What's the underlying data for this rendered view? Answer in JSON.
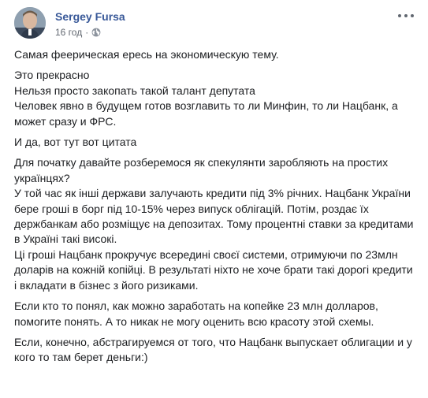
{
  "post": {
    "author": "Sergey Fursa",
    "timestamp": "16 год",
    "separator": "·",
    "privacy_icon": "globe-icon",
    "more_icon": "more-options-icon",
    "paragraphs": [
      {
        "lines": [
          "Самая феерическая ересь на экономическую тему."
        ]
      },
      {
        "lines": [
          "Это прекрасно",
          "Нельзя просто закопать такой талант депутата",
          "Человек явно в будущем готов возглавить то ли Минфин, то ли Нацбанк, а может сразу и ФРС."
        ]
      },
      {
        "lines": [
          "И да, вот тут вот цитата"
        ]
      },
      {
        "lines": [
          "Для початку давайте розберемося як спекулянти заробляють на простих українцях?",
          "У той час як інші держави залучають кредити під 3% річних. Нацбанк України бере гроші в борг під 10-15% через випуск облігацій. Потім, роздає їх держбанкам або розміщує на депозитах. Тому процентні ставки за кредитами в Україні такі високі.",
          "Ці гроші Нацбанк прокручує всередині своєї системи, отримуючи по 23млн доларів на кожній копійці. В результаті ніхто не хоче брати такі дорогі кредити і вкладати в бізнес з його ризиками."
        ]
      },
      {
        "lines": [
          "Если кто то понял, как можно заработать на копейке 23 млн долларов, помогите понять. А то никак не могу оценить всю красоту этой схемы."
        ]
      },
      {
        "lines": [
          "Если, конечно, абстрагируемся от того, что Нацбанк выпускает облигации и у кого то там берет деньги:)"
        ]
      }
    ]
  },
  "colors": {
    "author_link": "#385898",
    "meta_text": "#616770",
    "body_text": "#1c1e21",
    "background": "#ffffff"
  }
}
